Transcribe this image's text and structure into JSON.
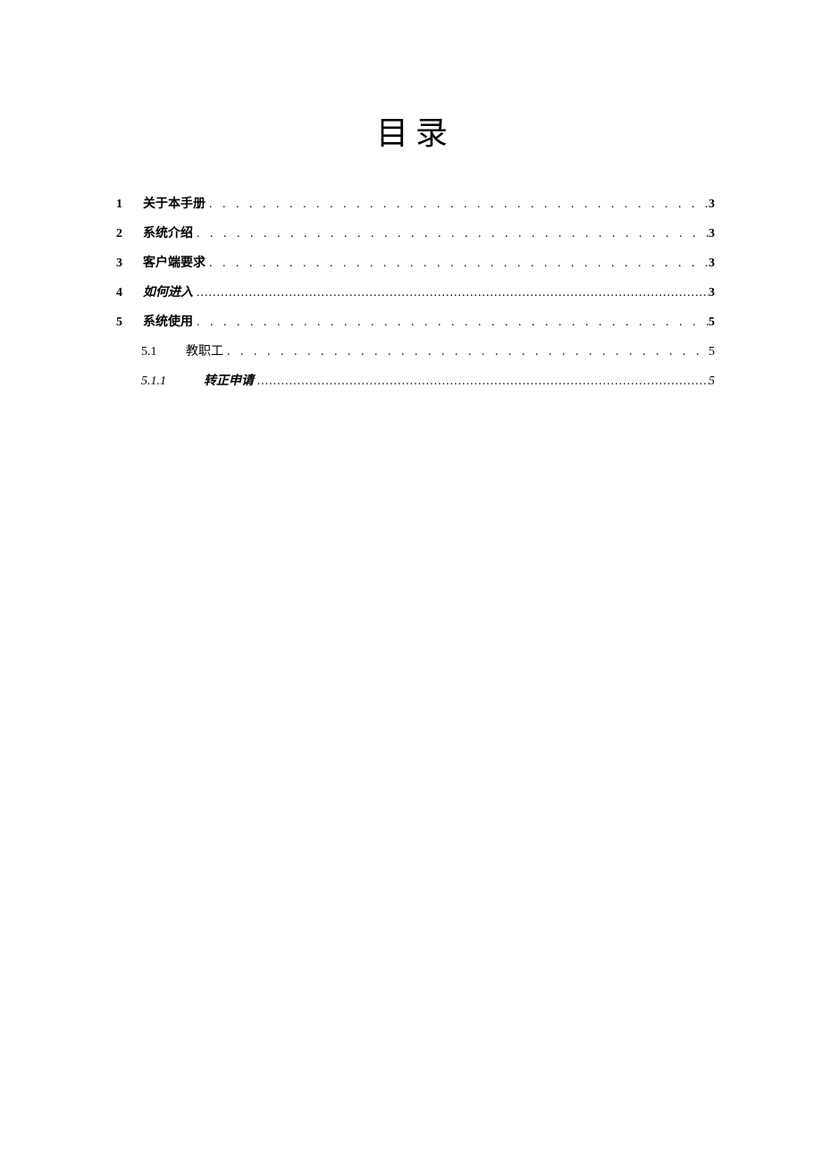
{
  "title": "目录",
  "entries": [
    {
      "level": 1,
      "number": "1",
      "label": "关于本手册",
      "page": "3",
      "italic": false,
      "tight": false
    },
    {
      "level": 1,
      "number": "2",
      "label": "系统介绍",
      "page": "3",
      "italic": false,
      "tight": false
    },
    {
      "level": 1,
      "number": "3",
      "label": "客户端要求",
      "page": "3",
      "italic": false,
      "tight": false
    },
    {
      "level": 1,
      "number": "4",
      "label": "如何进入",
      "page": "3",
      "italic": true,
      "tight": true
    },
    {
      "level": 1,
      "number": "5",
      "label": "系统使用",
      "page": "5",
      "italic": false,
      "tight": false
    },
    {
      "level": 2,
      "number": "5.1",
      "label": "教职工",
      "page": "5",
      "italic": false,
      "tight": false
    },
    {
      "level": 3,
      "number": "5.1.1",
      "label": "转正申请",
      "page": "5",
      "italic": true,
      "tight": true
    }
  ]
}
